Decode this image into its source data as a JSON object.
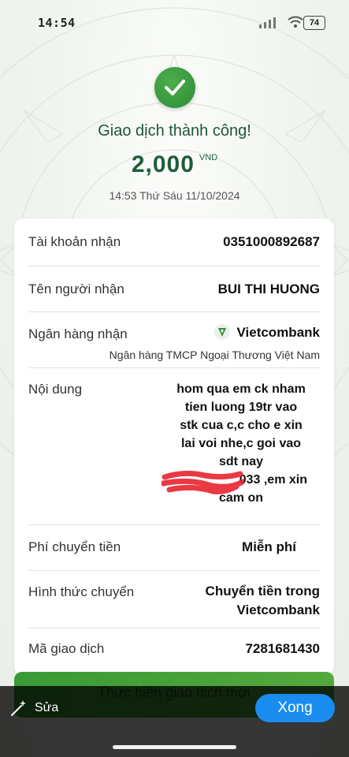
{
  "status_bar": {
    "time": "14:54",
    "battery": "74"
  },
  "header": {
    "title": "Giao dịch thành công!",
    "amount": "2,000",
    "currency": "VND",
    "datetime": "14:53 Thứ Sáu 11/10/2024"
  },
  "details": {
    "account_label": "Tài khoản nhận",
    "account_value": "0351000892687",
    "recipient_label": "Tên người nhận",
    "recipient_value": "BUI THI HUONG",
    "bank_label": "Ngân hàng nhận",
    "bank_value": "Vietcombank",
    "bank_full_name": "Ngân hàng TMCP Ngoại Thương Việt Nam",
    "content_label": "Nội dung",
    "content_lines": [
      "hom qua em ck nham",
      "tien luong 19tr vao",
      "stk cua c,c cho e xin",
      "lai voi nhe,c goi vao",
      "sdt nay",
      "033 ,em xin",
      "cam on"
    ],
    "fee_label": "Phí chuyển tiền",
    "fee_value": "Miễn phí",
    "method_label": "Hình thức chuyển",
    "method_value_1": "Chuyển tiền trong",
    "method_value_2": "Vietcombank",
    "txn_label": "Mã giao dịch",
    "txn_value": "7281681430"
  },
  "actions": {
    "new_transaction": "Thực hiện giao dịch mới",
    "edit": "Sửa",
    "done": "Xong"
  },
  "colors": {
    "brand_green": "#2e8b36",
    "done_blue": "#1a8cf0"
  }
}
